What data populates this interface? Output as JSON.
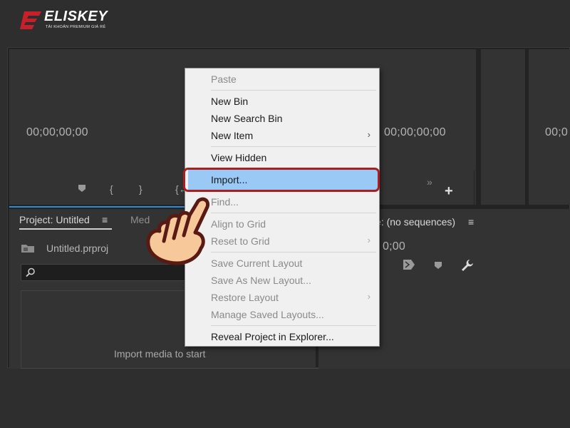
{
  "logo": {
    "word": "ELISKEY",
    "subtitle": "TÀI KHOẢN PREMIUM GIÁ RẺ",
    "brand_color": "#c8202a"
  },
  "source_monitor": {
    "timecode": "00;00;00;00"
  },
  "program_monitor_top": {
    "timecode": "00;00;00;00"
  },
  "right_monitor": {
    "timecode": "00;0"
  },
  "project_panel": {
    "tab_label": "Project: Untitled",
    "menu_icon": "≡",
    "media_tab": "Med",
    "file_name": "Untitled.prproj",
    "search_placeholder": "",
    "empty_text": "Import media to start"
  },
  "program_panel": {
    "tab_label": "e: (no sequences)",
    "menu_icon": "≡",
    "timecode": "0;00"
  },
  "context_menu": {
    "items": [
      {
        "label": "Paste",
        "disabled": true
      },
      {
        "label": "New Bin",
        "disabled": false
      },
      {
        "label": "New Search Bin",
        "disabled": false
      },
      {
        "label": "New Item",
        "disabled": false,
        "submenu": true
      },
      {
        "label": "View Hidden",
        "disabled": false
      },
      {
        "label": "Import...",
        "disabled": false,
        "highlighted": true
      },
      {
        "label": "Find...",
        "disabled": true
      },
      {
        "label": "Align to Grid",
        "disabled": true
      },
      {
        "label": "Reset to Grid",
        "disabled": true,
        "submenu": true
      },
      {
        "label": "Save Current Layout",
        "disabled": true
      },
      {
        "label": "Save As New Layout...",
        "disabled": true
      },
      {
        "label": "Restore Layout",
        "disabled": true,
        "submenu": true
      },
      {
        "label": "Manage Saved Layouts...",
        "disabled": true
      },
      {
        "label": "Reveal Project in Explorer...",
        "disabled": false
      }
    ],
    "highlight_color": "#99c9f4",
    "focus_ring_color": "#a71f23"
  },
  "colors": {
    "app_bg": "#232323",
    "panel_bg": "#333333",
    "accent_blue": "#2f8bd6"
  }
}
